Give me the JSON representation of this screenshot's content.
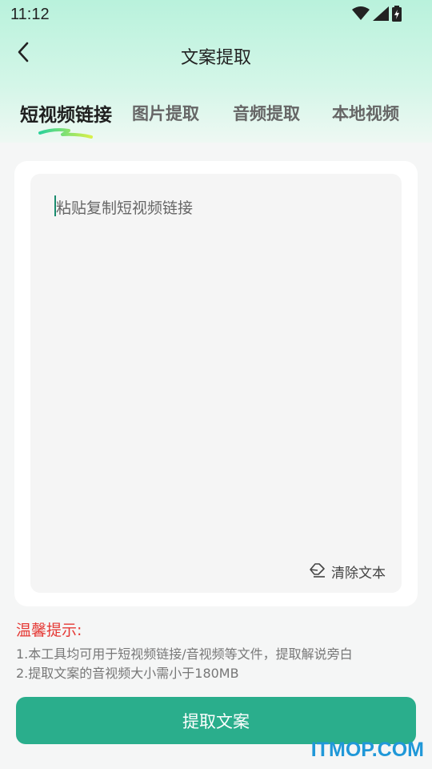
{
  "status_bar": {
    "time": "11:12"
  },
  "header": {
    "title": "文案提取"
  },
  "tabs": [
    {
      "label": "短视频链接",
      "active": true
    },
    {
      "label": "图片提取",
      "active": false
    },
    {
      "label": "音频提取",
      "active": false
    },
    {
      "label": "本地视频",
      "active": false
    }
  ],
  "input": {
    "placeholder": "粘贴复制短视频链接",
    "value": ""
  },
  "clear_button": {
    "label": "清除文本",
    "icon": "eraser-icon"
  },
  "tips": {
    "title": "温馨提示:",
    "lines": [
      "1.本工具均可用于短视频链接/音视频等文件，提取解说旁白",
      "2.提取文案的音视频大小需小于180MB"
    ]
  },
  "extract_button": {
    "label": "提取文案"
  },
  "watermark": "ITMOP.COM",
  "colors": {
    "accent": "#2aae8c",
    "tip_title": "#e53935",
    "header_bg": "#b9f2dc"
  }
}
